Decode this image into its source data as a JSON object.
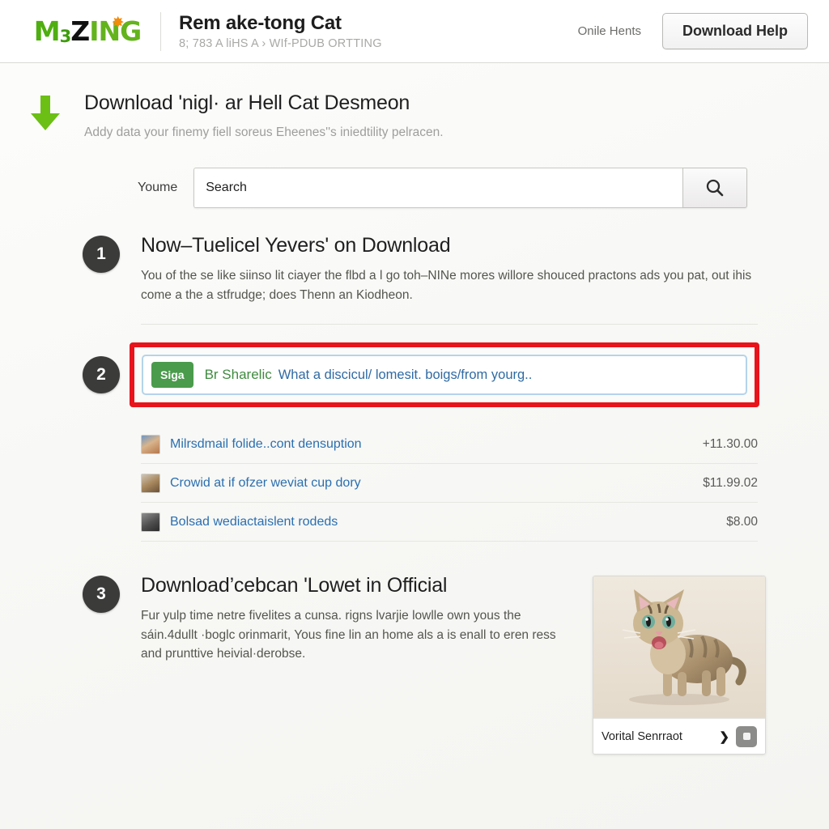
{
  "header": {
    "logo": {
      "part1": "M",
      "sup": "3",
      "part2": "Z",
      "part3": "ING",
      "star": "✸"
    },
    "title": "Rem ake-tong Cat",
    "subtitle": "8; 783 A liHS A  ›  WIf-PDUB ORTTING",
    "help_link": "Onile Hents",
    "help_button": "Download Help"
  },
  "intro": {
    "heading": "Download 'nigl· ar Hell Cat Desmeon",
    "paragraph": "Addy data your finemy fiell soreus Eheenes''s iniedtility pelracen."
  },
  "search": {
    "label": "Youme",
    "value": "Search",
    "placeholder": "Search",
    "icon": "search-icon"
  },
  "steps": [
    {
      "number": "1",
      "heading": "Now–Tuelicel Yevers' on Download",
      "paragraph": "You of the se like siinso lit ciayer the flbd a l go toh–NINe mores willore shouced practons ads you pat, out ihis come a the a stfrudge; does Thenn an Kiodheon."
    },
    {
      "number": "2"
    },
    {
      "number": "3",
      "heading": "Download’cebcan 'Lowet in Official",
      "paragraph": "Fur yulp time netre fivelites a cunsa. rigns lvarjie lowlle own yous the sáin.4dullt ·boglc orinmarit, Yous fine lin an home als a is enall to eren ress and prunttive heivial·derobse."
    }
  ],
  "promo": {
    "badge": "Siga",
    "green_text": "Br Sharelic",
    "blue_text": "What a discicul/ lomesit. boigs/from yourg..",
    "highlight_color": "#e8131b",
    "badge_color": "#4a9b4b"
  },
  "results": [
    {
      "thumb": "cat-thumbnail-1",
      "name": "Milrsdmail folide..cont densuption",
      "price": "+11.30.00"
    },
    {
      "thumb": "cat-thumbnail-2",
      "name": "Crowid at if ofzer weviat cup dory",
      "price": "$11.99.02"
    },
    {
      "thumb": "cat-thumbnail-3",
      "name": "Bolsad wediactaislent rodeds",
      "price": "$8.00"
    }
  ],
  "card": {
    "image_alt": "tabby-cat-photo",
    "caption": "Vorital Senrraot",
    "arrow": "❯",
    "button_icon": "square-button-icon"
  },
  "colors": {
    "accent_green": "#6cbf14",
    "link_blue": "#2a6fb0",
    "step_circle": "#3b3b3a"
  }
}
